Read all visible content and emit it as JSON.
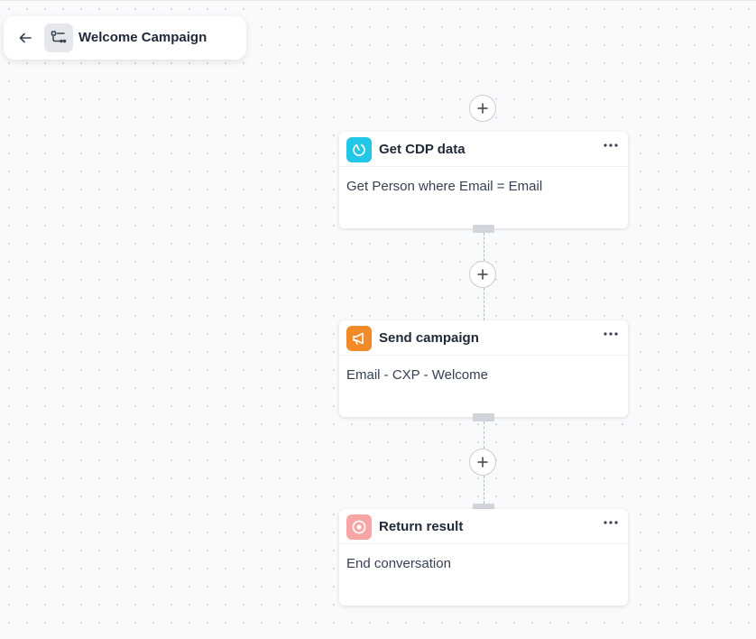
{
  "header": {
    "title": "Welcome Campaign",
    "back_icon": "arrow-left-icon",
    "workflow_icon": "workflow-icon"
  },
  "nodes": [
    {
      "title": "Get CDP data",
      "description": "Get Person where Email = Email",
      "icon": "cdp-data-icon",
      "icon_color": "#22c7e6"
    },
    {
      "title": "Send campaign",
      "description": "Email - CXP - Welcome",
      "icon": "megaphone-icon",
      "icon_color": "#f28a2a"
    },
    {
      "title": "Return result",
      "description": "End conversation",
      "icon": "stop-circle-icon",
      "icon_color": "#f7a5a5"
    }
  ],
  "colors": {
    "canvas_background": "#f9fafb",
    "card_background": "#ffffff",
    "connector": "#b6bbc2",
    "handle": "#d1d5db"
  }
}
